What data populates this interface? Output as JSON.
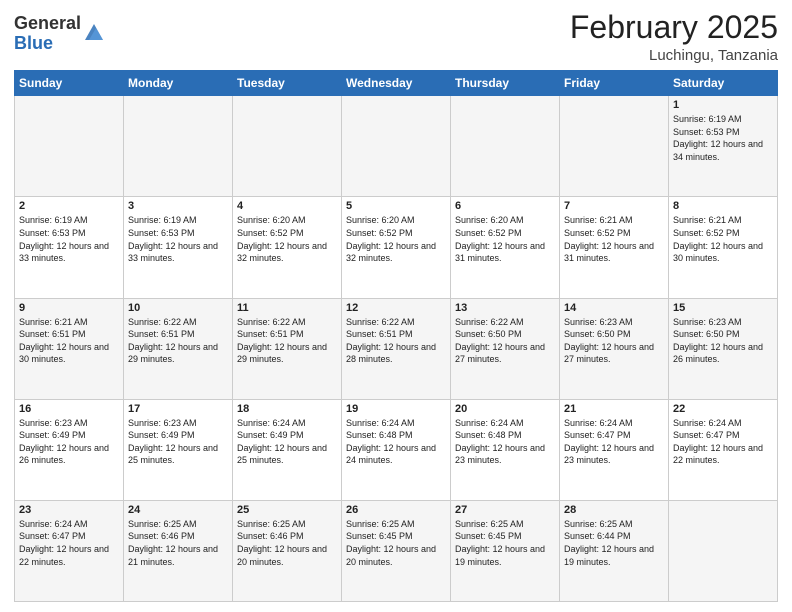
{
  "header": {
    "logo_general": "General",
    "logo_blue": "Blue",
    "month_title": "February 2025",
    "location": "Luchingu, Tanzania"
  },
  "days_of_week": [
    "Sunday",
    "Monday",
    "Tuesday",
    "Wednesday",
    "Thursday",
    "Friday",
    "Saturday"
  ],
  "weeks": [
    [
      {
        "day": "",
        "info": ""
      },
      {
        "day": "",
        "info": ""
      },
      {
        "day": "",
        "info": ""
      },
      {
        "day": "",
        "info": ""
      },
      {
        "day": "",
        "info": ""
      },
      {
        "day": "",
        "info": ""
      },
      {
        "day": "1",
        "info": "Sunrise: 6:19 AM\nSunset: 6:53 PM\nDaylight: 12 hours and 34 minutes."
      }
    ],
    [
      {
        "day": "2",
        "info": "Sunrise: 6:19 AM\nSunset: 6:53 PM\nDaylight: 12 hours and 33 minutes."
      },
      {
        "day": "3",
        "info": "Sunrise: 6:19 AM\nSunset: 6:53 PM\nDaylight: 12 hours and 33 minutes."
      },
      {
        "day": "4",
        "info": "Sunrise: 6:20 AM\nSunset: 6:52 PM\nDaylight: 12 hours and 32 minutes."
      },
      {
        "day": "5",
        "info": "Sunrise: 6:20 AM\nSunset: 6:52 PM\nDaylight: 12 hours and 32 minutes."
      },
      {
        "day": "6",
        "info": "Sunrise: 6:20 AM\nSunset: 6:52 PM\nDaylight: 12 hours and 31 minutes."
      },
      {
        "day": "7",
        "info": "Sunrise: 6:21 AM\nSunset: 6:52 PM\nDaylight: 12 hours and 31 minutes."
      },
      {
        "day": "8",
        "info": "Sunrise: 6:21 AM\nSunset: 6:52 PM\nDaylight: 12 hours and 30 minutes."
      }
    ],
    [
      {
        "day": "9",
        "info": "Sunrise: 6:21 AM\nSunset: 6:51 PM\nDaylight: 12 hours and 30 minutes."
      },
      {
        "day": "10",
        "info": "Sunrise: 6:22 AM\nSunset: 6:51 PM\nDaylight: 12 hours and 29 minutes."
      },
      {
        "day": "11",
        "info": "Sunrise: 6:22 AM\nSunset: 6:51 PM\nDaylight: 12 hours and 29 minutes."
      },
      {
        "day": "12",
        "info": "Sunrise: 6:22 AM\nSunset: 6:51 PM\nDaylight: 12 hours and 28 minutes."
      },
      {
        "day": "13",
        "info": "Sunrise: 6:22 AM\nSunset: 6:50 PM\nDaylight: 12 hours and 27 minutes."
      },
      {
        "day": "14",
        "info": "Sunrise: 6:23 AM\nSunset: 6:50 PM\nDaylight: 12 hours and 27 minutes."
      },
      {
        "day": "15",
        "info": "Sunrise: 6:23 AM\nSunset: 6:50 PM\nDaylight: 12 hours and 26 minutes."
      }
    ],
    [
      {
        "day": "16",
        "info": "Sunrise: 6:23 AM\nSunset: 6:49 PM\nDaylight: 12 hours and 26 minutes."
      },
      {
        "day": "17",
        "info": "Sunrise: 6:23 AM\nSunset: 6:49 PM\nDaylight: 12 hours and 25 minutes."
      },
      {
        "day": "18",
        "info": "Sunrise: 6:24 AM\nSunset: 6:49 PM\nDaylight: 12 hours and 25 minutes."
      },
      {
        "day": "19",
        "info": "Sunrise: 6:24 AM\nSunset: 6:48 PM\nDaylight: 12 hours and 24 minutes."
      },
      {
        "day": "20",
        "info": "Sunrise: 6:24 AM\nSunset: 6:48 PM\nDaylight: 12 hours and 23 minutes."
      },
      {
        "day": "21",
        "info": "Sunrise: 6:24 AM\nSunset: 6:47 PM\nDaylight: 12 hours and 23 minutes."
      },
      {
        "day": "22",
        "info": "Sunrise: 6:24 AM\nSunset: 6:47 PM\nDaylight: 12 hours and 22 minutes."
      }
    ],
    [
      {
        "day": "23",
        "info": "Sunrise: 6:24 AM\nSunset: 6:47 PM\nDaylight: 12 hours and 22 minutes."
      },
      {
        "day": "24",
        "info": "Sunrise: 6:25 AM\nSunset: 6:46 PM\nDaylight: 12 hours and 21 minutes."
      },
      {
        "day": "25",
        "info": "Sunrise: 6:25 AM\nSunset: 6:46 PM\nDaylight: 12 hours and 20 minutes."
      },
      {
        "day": "26",
        "info": "Sunrise: 6:25 AM\nSunset: 6:45 PM\nDaylight: 12 hours and 20 minutes."
      },
      {
        "day": "27",
        "info": "Sunrise: 6:25 AM\nSunset: 6:45 PM\nDaylight: 12 hours and 19 minutes."
      },
      {
        "day": "28",
        "info": "Sunrise: 6:25 AM\nSunset: 6:44 PM\nDaylight: 12 hours and 19 minutes."
      },
      {
        "day": "",
        "info": ""
      }
    ]
  ]
}
